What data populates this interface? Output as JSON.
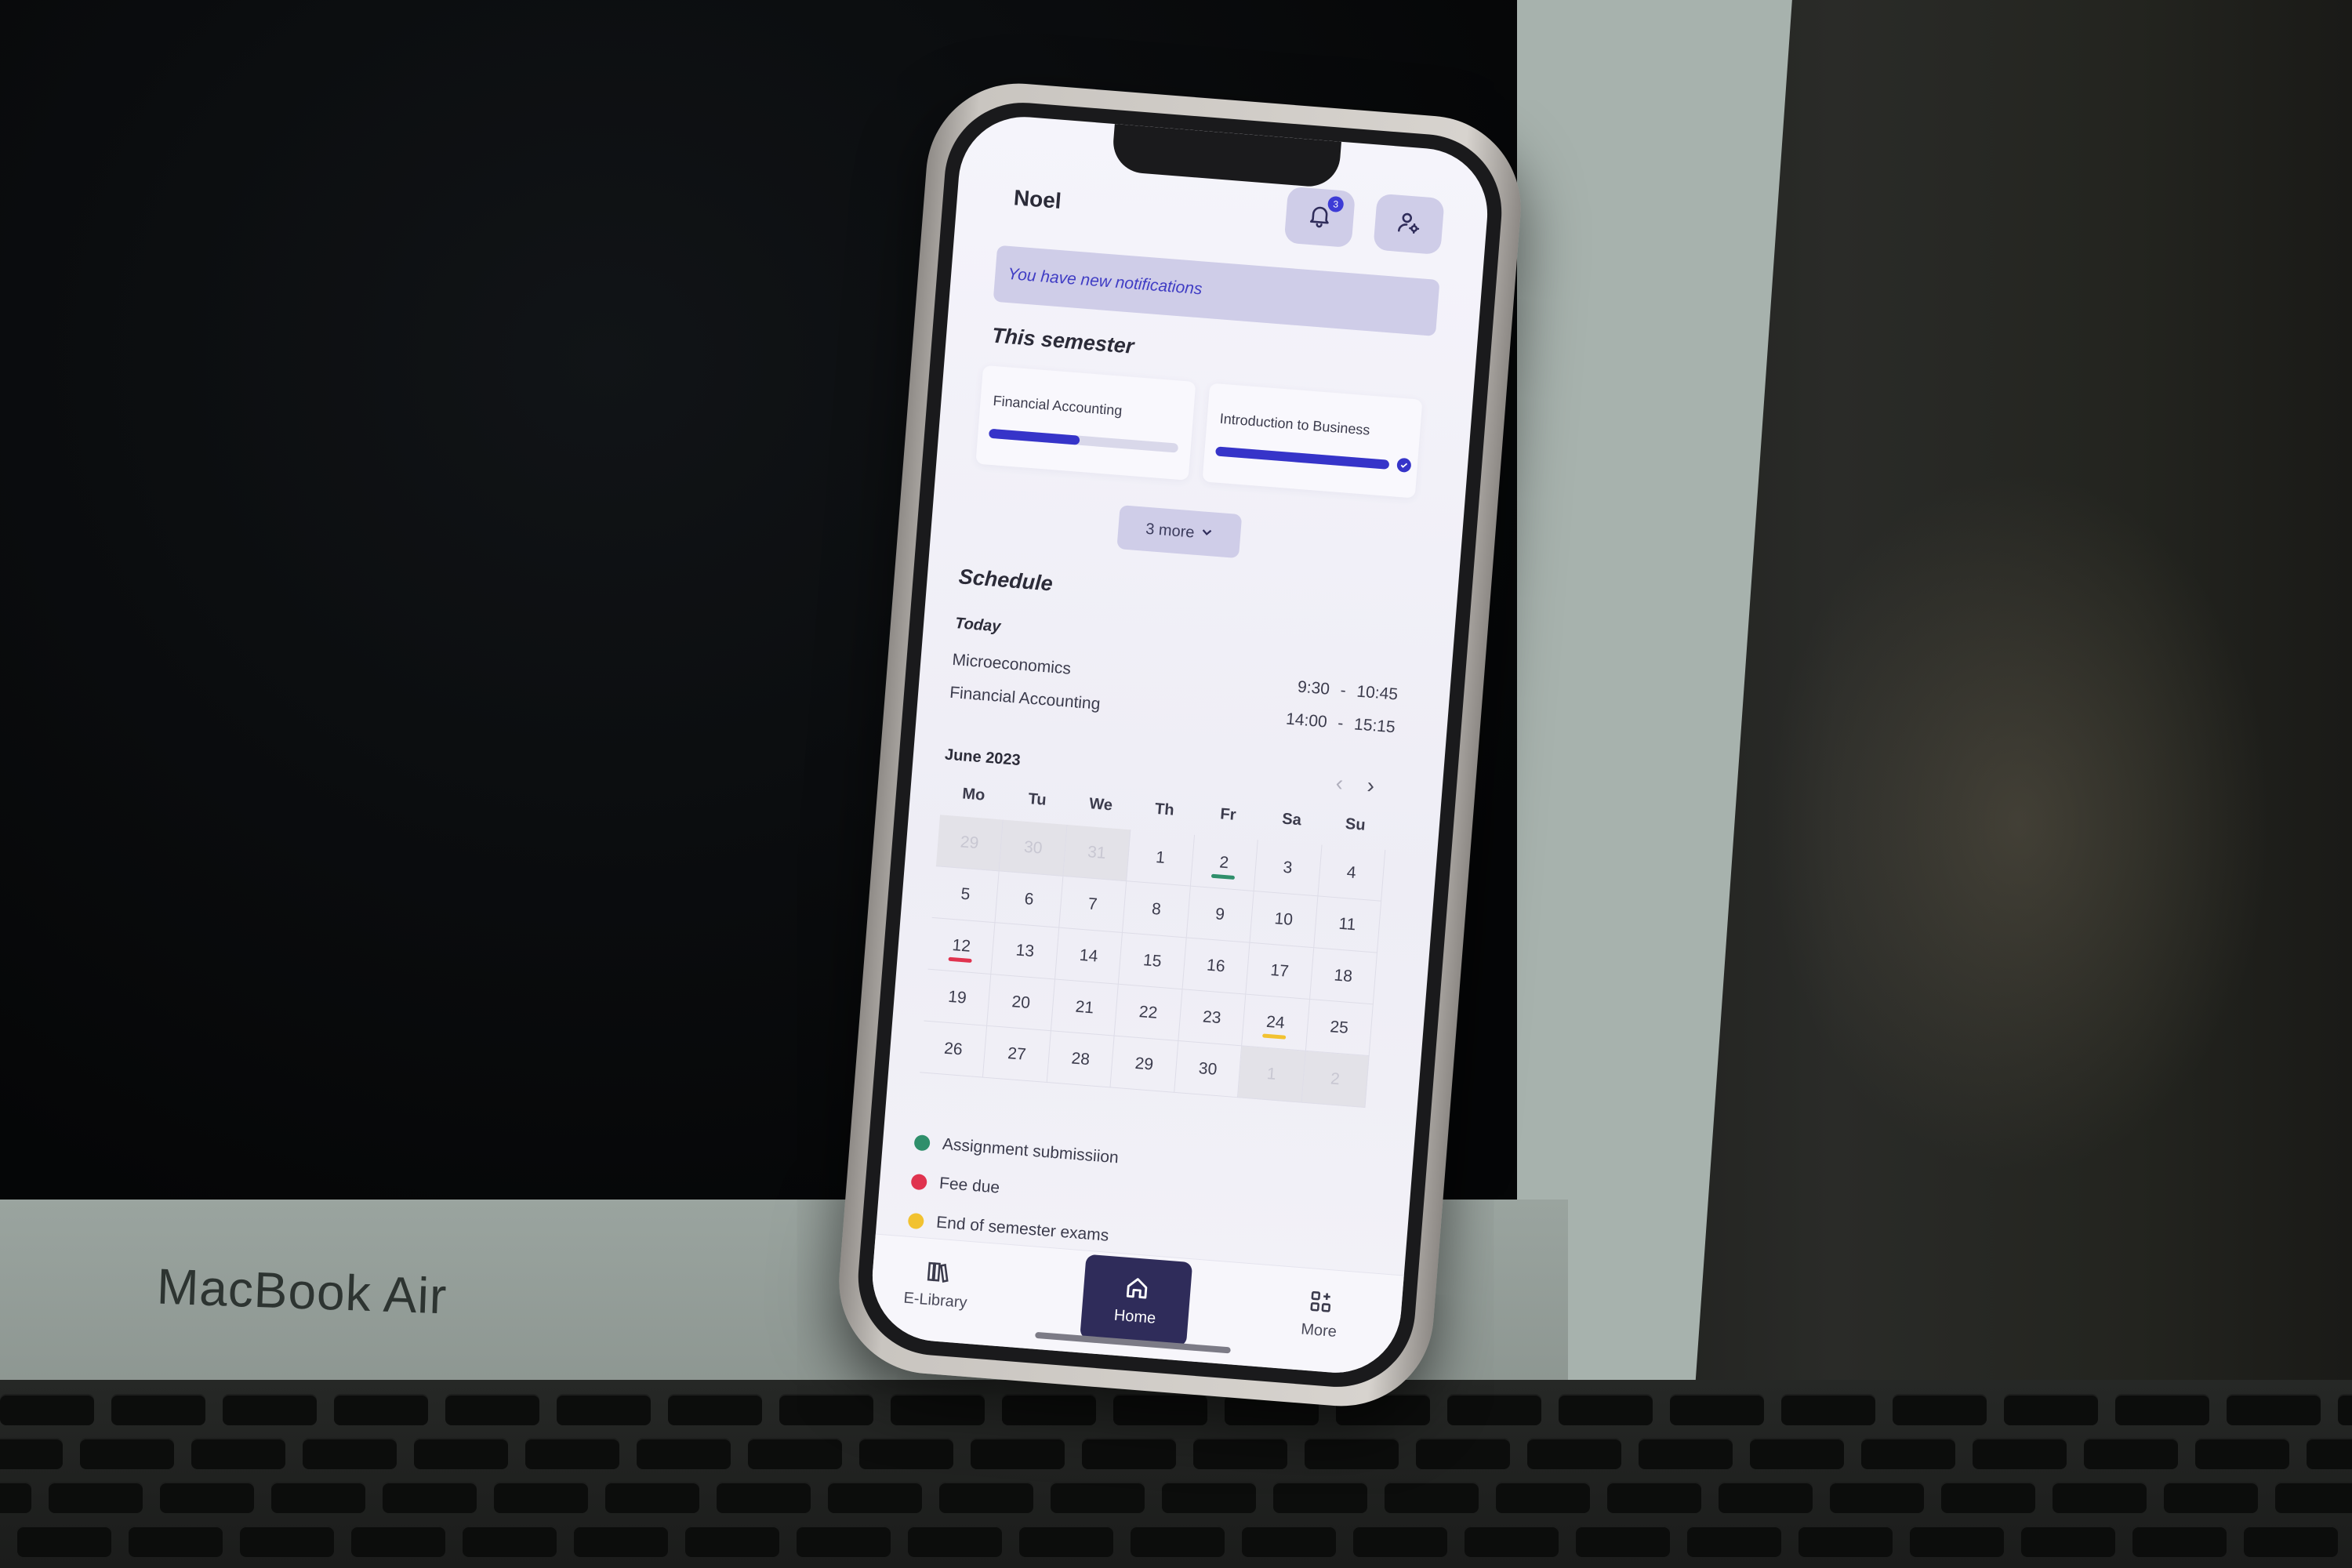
{
  "background": {
    "laptop_brand_label": "MacBook Air"
  },
  "header": {
    "user_name": "Noel",
    "notification_count": "3",
    "icons": [
      "bell-icon",
      "user-settings-icon"
    ]
  },
  "notification_banner": {
    "text": "You have new notifications"
  },
  "semester": {
    "title": "This semester",
    "courses": [
      {
        "name": "Financial Accounting",
        "progress": 0.48,
        "completed": false
      },
      {
        "name": "Introduction to Business",
        "progress": 1.0,
        "completed": true
      }
    ],
    "more_label": "3 more"
  },
  "schedule": {
    "title": "Schedule",
    "today_label": "Today",
    "classes": [
      {
        "name": "Microeconomics",
        "time": "9:30 - 10:45"
      },
      {
        "name": "Financial Accounting",
        "time": "14:00 - 15:15"
      }
    ]
  },
  "calendar": {
    "month_label": "June 2023",
    "weekdays": [
      "Mo",
      "Tu",
      "We",
      "Th",
      "Fr",
      "Sa",
      "Su"
    ],
    "days": [
      {
        "d": "29",
        "out": true
      },
      {
        "d": "30",
        "out": true
      },
      {
        "d": "31",
        "out": true
      },
      {
        "d": "1"
      },
      {
        "d": "2",
        "mark": "assignment"
      },
      {
        "d": "3"
      },
      {
        "d": "4"
      },
      {
        "d": "5"
      },
      {
        "d": "6"
      },
      {
        "d": "7"
      },
      {
        "d": "8"
      },
      {
        "d": "9"
      },
      {
        "d": "10"
      },
      {
        "d": "11"
      },
      {
        "d": "12",
        "mark": "fee"
      },
      {
        "d": "13"
      },
      {
        "d": "14"
      },
      {
        "d": "15"
      },
      {
        "d": "16"
      },
      {
        "d": "17"
      },
      {
        "d": "18"
      },
      {
        "d": "19"
      },
      {
        "d": "20"
      },
      {
        "d": "21"
      },
      {
        "d": "22"
      },
      {
        "d": "23"
      },
      {
        "d": "24",
        "mark": "exam"
      },
      {
        "d": "25"
      },
      {
        "d": "26"
      },
      {
        "d": "27"
      },
      {
        "d": "28"
      },
      {
        "d": "29"
      },
      {
        "d": "30"
      },
      {
        "d": "1",
        "out": true
      },
      {
        "d": "2",
        "out": true
      }
    ]
  },
  "legend": [
    {
      "key": "assignment",
      "label": "Assignment submissiion",
      "color": "#2f8f6b"
    },
    {
      "key": "fee",
      "label": "Fee due",
      "color": "#e0334f"
    },
    {
      "key": "exam",
      "label": "End of semester exams",
      "color": "#f2c230"
    }
  ],
  "tabbar": {
    "library_label": "E-Library",
    "home_label": "Home",
    "more_label": "More"
  },
  "colors": {
    "accent": "#3634c9",
    "pill": "#cfcde8",
    "home_tab": "#2f2c5a"
  }
}
